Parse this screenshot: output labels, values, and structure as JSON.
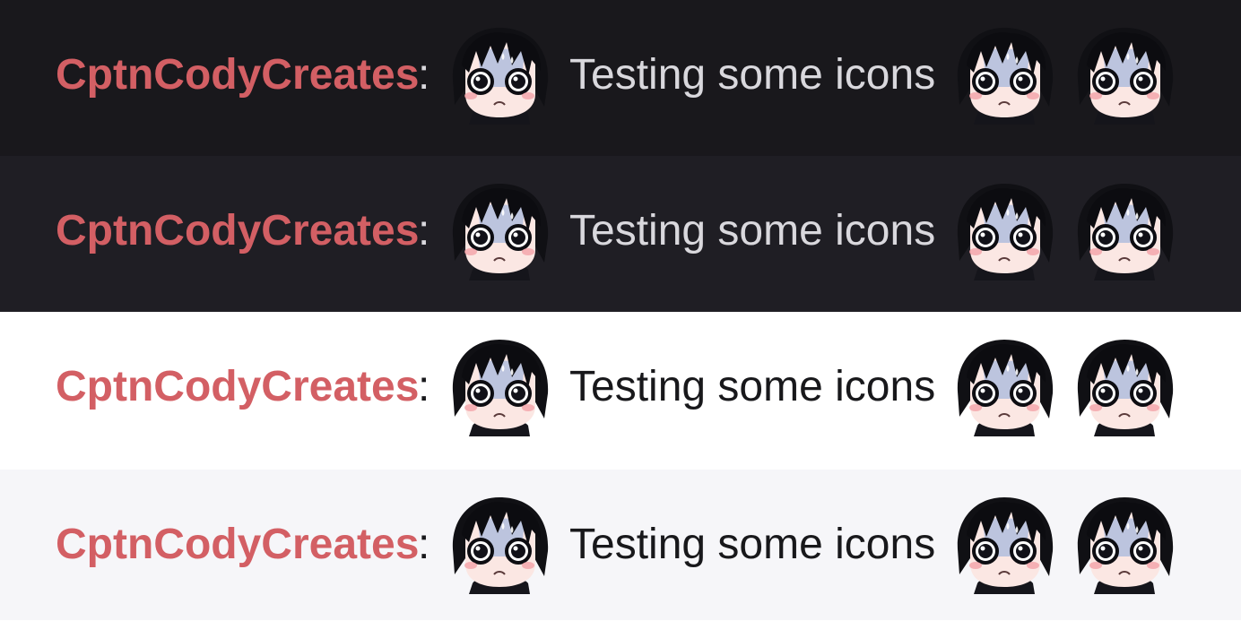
{
  "rows": [
    {
      "theme": "dark",
      "bg": "#19181c",
      "text_color": "#d9d8dd",
      "username": "CptnCodyCreates",
      "separator": ":",
      "message": "Testing some icons"
    },
    {
      "theme": "dark-alt",
      "bg": "#1f1e24",
      "text_color": "#d9d8dd",
      "username": "CptnCodyCreates",
      "separator": ":",
      "message": "Testing some icons"
    },
    {
      "theme": "light",
      "bg": "#ffffff",
      "text_color": "#18181b",
      "username": "CptnCodyCreates",
      "separator": ":",
      "message": "Testing some icons"
    },
    {
      "theme": "light-alt",
      "bg": "#f6f6f9",
      "text_color": "#18181b",
      "username": "CptnCodyCreates",
      "separator": ":",
      "message": "Testing some icons"
    }
  ],
  "colors": {
    "username": "#d35f64"
  },
  "emote_icon": "anime-chibi-nervous-face-icon"
}
